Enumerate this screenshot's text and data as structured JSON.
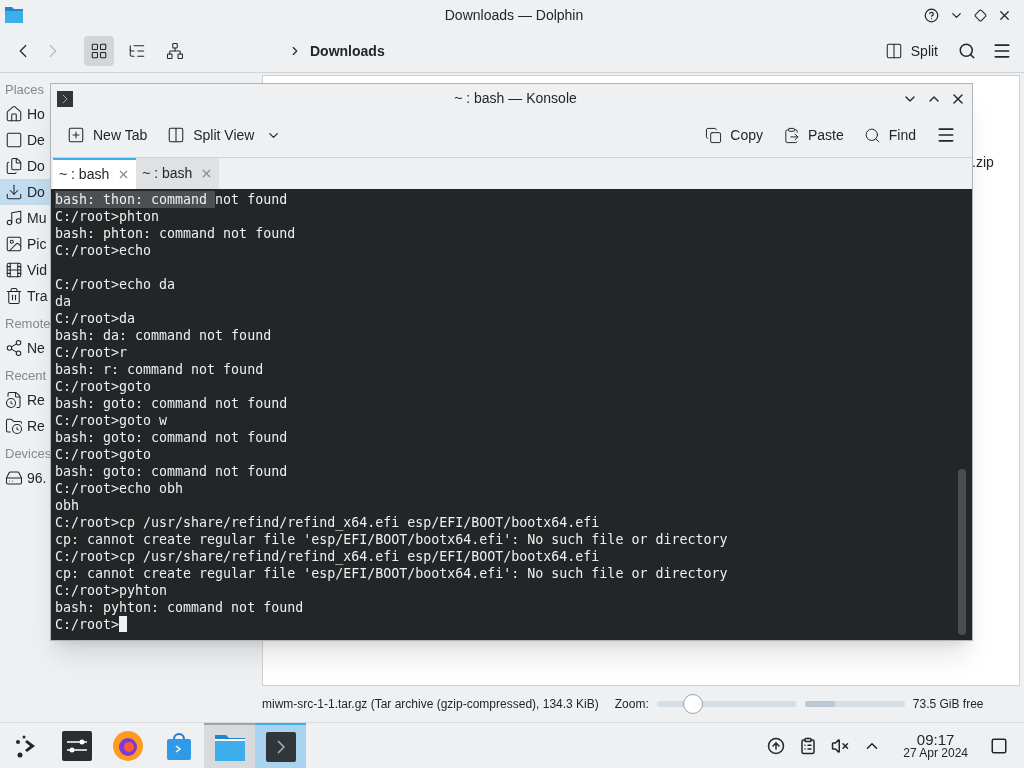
{
  "dolphin": {
    "title": "Downloads — Dolphin",
    "view_modes": [
      {
        "selected": true
      },
      {
        "selected": false
      },
      {
        "selected": false
      }
    ],
    "breadcrumb": "Downloads",
    "split_label": "Split",
    "sidebar": [
      {
        "title": "Places",
        "items": [
          {
            "label": "Ho",
            "selected": false
          },
          {
            "label": "De",
            "selected": false
          },
          {
            "label": "Do",
            "selected": false
          },
          {
            "label": "Do",
            "selected": true
          },
          {
            "label": "Mu",
            "selected": false
          },
          {
            "label": "Pic",
            "selected": false
          },
          {
            "label": "Vid",
            "selected": false
          },
          {
            "label": "Tra",
            "selected": false
          }
        ]
      },
      {
        "title": "Remote",
        "items": [
          {
            "label": "Ne",
            "selected": false
          }
        ]
      },
      {
        "title": "Recent",
        "items": [
          {
            "label": "Re",
            "selected": false
          },
          {
            "label": "Re",
            "selected": false
          }
        ]
      },
      {
        "title": "Devices",
        "items": [
          {
            "label": "96.",
            "selected": false
          }
        ]
      }
    ],
    "file_fragment": ".zip",
    "status": {
      "text": "miwm-src-1-1.tar.gz (Tar archive (gzip-compressed), 134.3 KiB)",
      "zoom_label": "Zoom:",
      "zoom": {
        "level": 0.22
      },
      "space": {
        "level": 0.3
      },
      "free": "73.5 GiB free"
    }
  },
  "konsole": {
    "title": "~ : bash — Konsole",
    "toolbar": {
      "new_tab": "New Tab",
      "split_view": "Split View",
      "copy": "Copy",
      "paste": "Paste",
      "find": "Find"
    },
    "tabs": [
      {
        "label": "~ : bash",
        "selected": true
      },
      {
        "label": "~ : bash",
        "selected": false
      }
    ],
    "lines": [
      {
        "kind": "text",
        "parts": [
          {
            "text": "bash: thon: command ",
            "selected": true
          },
          {
            "text": "not found",
            "selected": false
          }
        ]
      },
      {
        "kind": "text",
        "parts": [
          {
            "text": "C:/root>phton",
            "selected": false
          }
        ]
      },
      {
        "kind": "text",
        "parts": [
          {
            "text": "bash: phton: command not found",
            "selected": false
          }
        ]
      },
      {
        "kind": "text",
        "parts": [
          {
            "text": "C:/root>echo",
            "selected": false
          }
        ]
      },
      {
        "kind": "blank"
      },
      {
        "kind": "text",
        "parts": [
          {
            "text": "C:/root>echo da",
            "selected": false
          }
        ]
      },
      {
        "kind": "text",
        "parts": [
          {
            "text": "da",
            "selected": false
          }
        ]
      },
      {
        "kind": "text",
        "parts": [
          {
            "text": "C:/root>da",
            "selected": false
          }
        ]
      },
      {
        "kind": "text",
        "parts": [
          {
            "text": "bash: da: command not found",
            "selected": false
          }
        ]
      },
      {
        "kind": "text",
        "parts": [
          {
            "text": "C:/root>r",
            "selected": false
          }
        ]
      },
      {
        "kind": "text",
        "parts": [
          {
            "text": "bash: r: command not found",
            "selected": false
          }
        ]
      },
      {
        "kind": "text",
        "parts": [
          {
            "text": "C:/root>goto",
            "selected": false
          }
        ]
      },
      {
        "kind": "text",
        "parts": [
          {
            "text": "bash: goto: command not found",
            "selected": false
          }
        ]
      },
      {
        "kind": "text",
        "parts": [
          {
            "text": "C:/root>goto w",
            "selected": false
          }
        ]
      },
      {
        "kind": "text",
        "parts": [
          {
            "text": "bash: goto: command not found",
            "selected": false
          }
        ]
      },
      {
        "kind": "text",
        "parts": [
          {
            "text": "C:/root>goto",
            "selected": false
          }
        ]
      },
      {
        "kind": "text",
        "parts": [
          {
            "text": "bash: goto: command not found",
            "selected": false
          }
        ]
      },
      {
        "kind": "text",
        "parts": [
          {
            "text": "C:/root>echo obh",
            "selected": false
          }
        ]
      },
      {
        "kind": "text",
        "parts": [
          {
            "text": "obh",
            "selected": false
          }
        ]
      },
      {
        "kind": "text",
        "parts": [
          {
            "text": "C:/root>cp /usr/share/refind/refind_x64.efi esp/EFI/BOOT/bootx64.efi",
            "selected": false
          }
        ]
      },
      {
        "kind": "text",
        "parts": [
          {
            "text": "cp: cannot create regular file 'esp/EFI/BOOT/bootx64.efi': No such file or directory",
            "selected": false
          }
        ]
      },
      {
        "kind": "text",
        "parts": [
          {
            "text": "C:/root>cp /usr/share/refind/refind_x64.efi esp/EFI/BOOT/bootx64.efi",
            "selected": false
          }
        ]
      },
      {
        "kind": "text",
        "parts": [
          {
            "text": "cp: cannot create regular file 'esp/EFI/BOOT/bootx64.efi': No such file or directory",
            "selected": false
          }
        ]
      },
      {
        "kind": "text",
        "parts": [
          {
            "text": "C:/root>pyhton",
            "selected": false
          }
        ]
      },
      {
        "kind": "text",
        "parts": [
          {
            "text": "bash: pyhton: command not found",
            "selected": false
          }
        ]
      },
      {
        "kind": "text",
        "cursor": true,
        "parts": [
          {
            "text": "C:/root>",
            "selected": false
          }
        ]
      }
    ]
  },
  "taskbar": {
    "apps": [
      {
        "selected": false,
        "open": false
      },
      {
        "selected": false,
        "open": false
      },
      {
        "selected": false,
        "open": false
      },
      {
        "selected": false,
        "open": false
      },
      {
        "selected": false,
        "open": true
      },
      {
        "selected": true,
        "open": true
      }
    ],
    "time": "09:17",
    "date": "27 Apr 2024"
  }
}
